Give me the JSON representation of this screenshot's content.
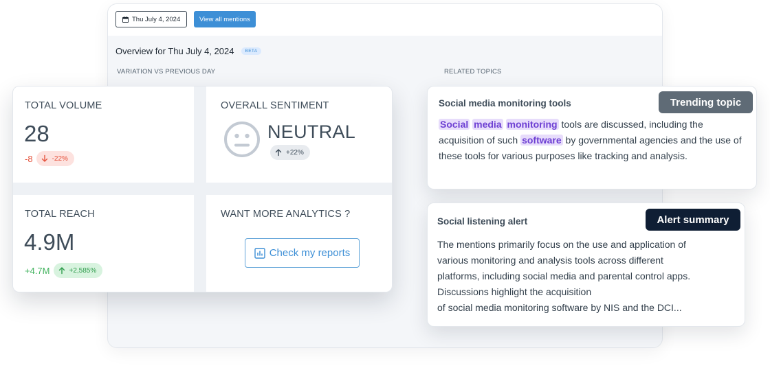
{
  "toolbar": {
    "date_label": "Thu July 4, 2024",
    "view_mentions_label": "View all mentions"
  },
  "overview": {
    "title": "Overview for Thu July 4, 2024",
    "badge": "BETA"
  },
  "sections": {
    "variation_label": "VARIATION VS PREVIOUS DAY",
    "related_label": "RELATED TOPICS"
  },
  "stats": {
    "volume": {
      "title": "TOTAL VOLUME",
      "value": "28",
      "delta": "-8",
      "delta_pct": "-22%",
      "trend": "down"
    },
    "sentiment": {
      "title": "OVERALL SENTIMENT",
      "value": "NEUTRAL",
      "delta_pct": "+22%",
      "trend": "up",
      "icon": "neutral-face-icon"
    },
    "reach": {
      "title": "TOTAL REACH",
      "value": "4.9M",
      "delta": "+4.7M",
      "delta_pct": "+2,585%",
      "trend": "up"
    },
    "analytics": {
      "title": "WANT MORE ANALYTICS ?",
      "button_label": "Check my reports",
      "icon": "bar-chart-icon"
    }
  },
  "topics": [
    {
      "title": "Social media monitoring tools",
      "tag": "Trending topic",
      "segments": [
        {
          "text": "Social",
          "highlight": true
        },
        {
          "text": " ",
          "highlight": false
        },
        {
          "text": "media",
          "highlight": true
        },
        {
          "text": " ",
          "highlight": false
        },
        {
          "text": "monitoring",
          "highlight": true
        },
        {
          "text": " tools are discussed, including the acquisition of such ",
          "highlight": false
        },
        {
          "text": "software",
          "highlight": true
        },
        {
          "text": " by governmental agencies and the use of these tools for various purposes like tracking and analysis.",
          "highlight": false
        }
      ]
    },
    {
      "title": "Social listening alert",
      "tag": "Alert summary",
      "lines": [
        "The mentions primarily focus on the use and application of",
        "various monitoring and analysis tools across different",
        "platforms, including social media and parental control apps.",
        "Discussions highlight the acquisition",
        "of social media monitoring software by NIS and the DCI..."
      ]
    }
  ],
  "colors": {
    "accent": "#3d8fd6",
    "negative": "#e5533d",
    "positive": "#3fb25c",
    "highlight_text": "#6d3fd3",
    "highlight_bg": "#e7dcfb",
    "tag_trending": "#5f6b76",
    "tag_alert": "#0f1e34"
  }
}
